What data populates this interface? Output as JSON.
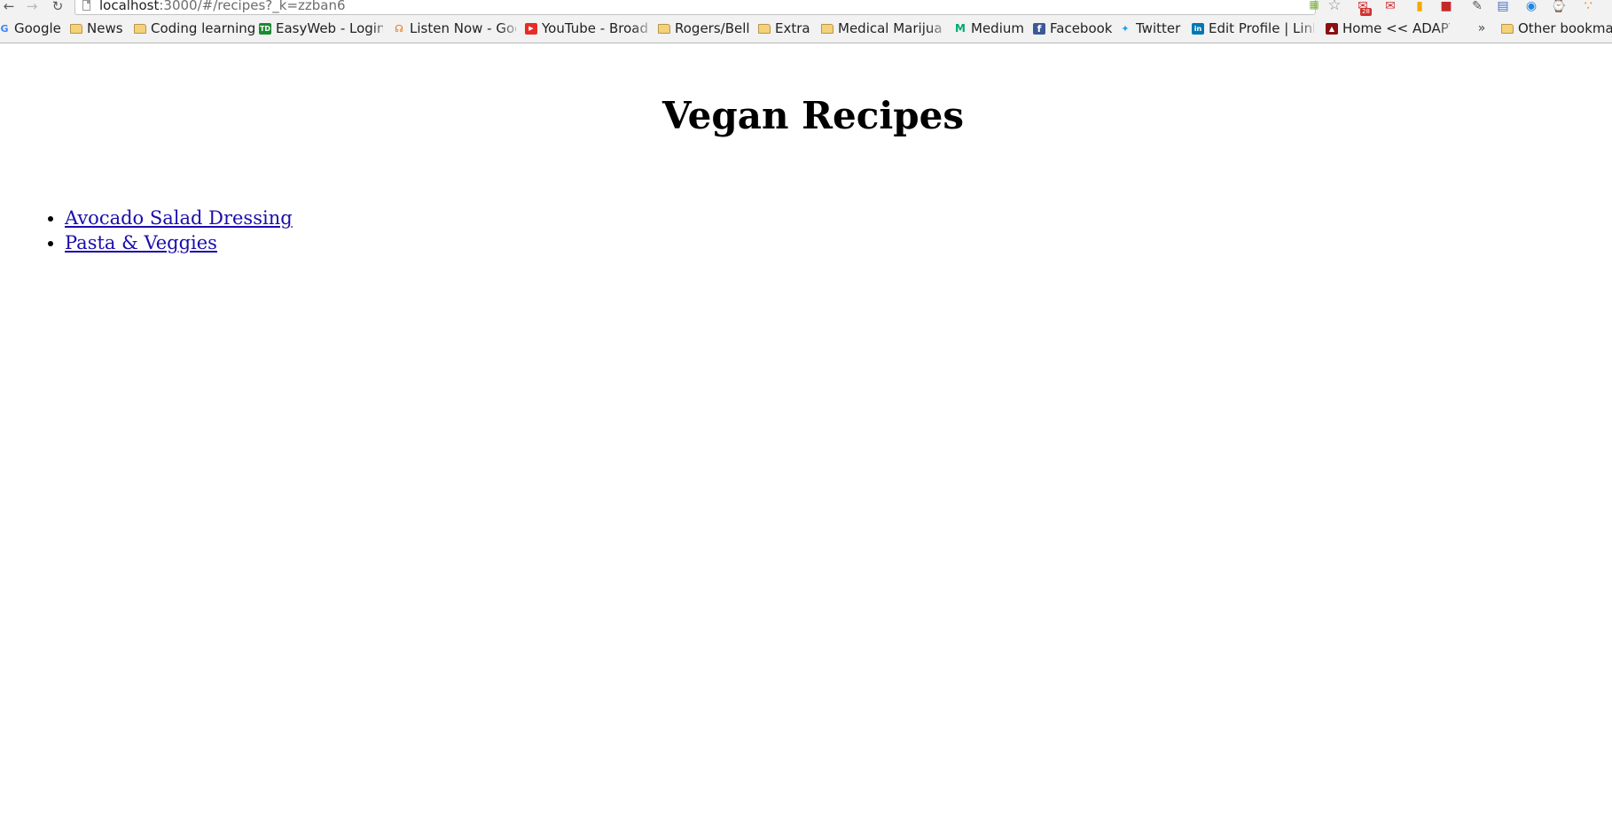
{
  "browser": {
    "nav": {
      "back_icon": "arrow-left-icon",
      "forward_icon": "arrow-right-icon",
      "reload_icon": "reload-icon"
    },
    "url": {
      "host": "localhost",
      "path": ":3000/#/recipes?_k=zzban6"
    },
    "extensions": [
      {
        "name": "page-action-icon"
      },
      {
        "name": "bookmark-star-icon"
      },
      {
        "name": "gmail-icon",
        "badge": "28"
      },
      {
        "name": "gmail-checker-icon"
      },
      {
        "name": "feedly-icon"
      },
      {
        "name": "bookmark-red-icon"
      },
      {
        "name": "pencil-icon"
      },
      {
        "name": "calendar-icon"
      },
      {
        "name": "camera-icon"
      },
      {
        "name": "timer-icon"
      },
      {
        "name": "rss-icon"
      }
    ]
  },
  "bookmarks": {
    "items": [
      {
        "label": "Google",
        "icon": "google-icon",
        "color": "#4285f4"
      },
      {
        "label": "News",
        "icon": "folder-icon"
      },
      {
        "label": "Coding learning",
        "icon": "folder-icon"
      },
      {
        "label": "EasyWeb - Login t",
        "icon": "td-bank-icon",
        "color": "#1a8a2e"
      },
      {
        "label": "Listen Now - Goo",
        "icon": "headphones-icon",
        "color": "#ef6c00"
      },
      {
        "label": "YouTube - Broadc",
        "icon": "youtube-icon",
        "color": "#e52d27"
      },
      {
        "label": "Rogers/Bell",
        "icon": "folder-icon"
      },
      {
        "label": "Extra",
        "icon": "folder-icon"
      },
      {
        "label": "Medical Marijuan",
        "icon": "folder-icon"
      },
      {
        "label": "Medium",
        "icon": "medium-icon",
        "color": "#00ab6c"
      },
      {
        "label": "Facebook",
        "icon": "facebook-icon",
        "color": "#3b5998"
      },
      {
        "label": "Twitter",
        "icon": "twitter-icon",
        "color": "#1da1f2"
      },
      {
        "label": "Edit Profile | Link",
        "icon": "linkedin-icon",
        "color": "#0077b5"
      },
      {
        "label": "Home << ADAPTI",
        "icon": "adapt-icon",
        "color": "#8b1010"
      }
    ],
    "overflow_label": "»",
    "other_label": "Other bookmar"
  },
  "page": {
    "title": "Vegan Recipes",
    "recipes": [
      {
        "label": "Avocado Salad Dressing"
      },
      {
        "label": "Pasta & Veggies"
      }
    ]
  }
}
